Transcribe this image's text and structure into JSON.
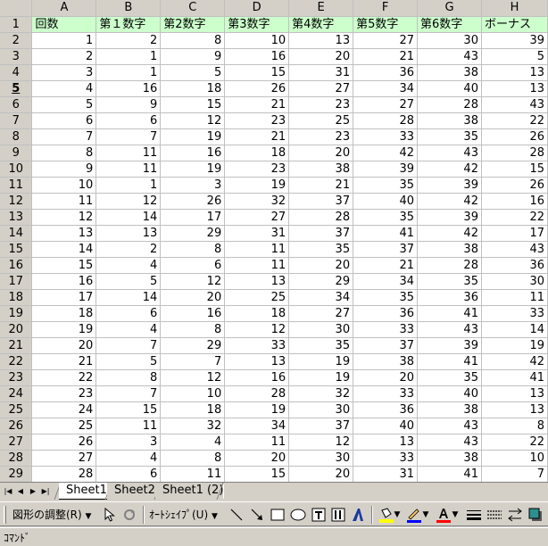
{
  "columns": [
    "A",
    "B",
    "C",
    "D",
    "E",
    "F",
    "G",
    "H"
  ],
  "header_row": [
    "回数",
    "第１数字",
    "第2数字",
    "第3数字",
    "第4数字",
    "第5数字",
    "第6数字",
    "ボーナス"
  ],
  "active_row": "5",
  "rows": [
    [
      1,
      2,
      8,
      10,
      13,
      27,
      30,
      39
    ],
    [
      2,
      1,
      9,
      16,
      20,
      21,
      43,
      5
    ],
    [
      3,
      1,
      5,
      15,
      31,
      36,
      38,
      13
    ],
    [
      4,
      16,
      18,
      26,
      27,
      34,
      40,
      13
    ],
    [
      5,
      9,
      15,
      21,
      23,
      27,
      28,
      43
    ],
    [
      6,
      6,
      12,
      23,
      25,
      28,
      38,
      22
    ],
    [
      7,
      7,
      19,
      21,
      23,
      33,
      35,
      26
    ],
    [
      8,
      11,
      16,
      18,
      20,
      42,
      43,
      28
    ],
    [
      9,
      11,
      19,
      23,
      38,
      39,
      42,
      15
    ],
    [
      10,
      1,
      3,
      19,
      21,
      35,
      39,
      26
    ],
    [
      11,
      12,
      26,
      32,
      37,
      40,
      42,
      16
    ],
    [
      12,
      14,
      17,
      27,
      28,
      35,
      39,
      22
    ],
    [
      13,
      13,
      29,
      31,
      37,
      41,
      42,
      17
    ],
    [
      14,
      2,
      8,
      11,
      35,
      37,
      38,
      43
    ],
    [
      15,
      4,
      6,
      11,
      20,
      21,
      28,
      36
    ],
    [
      16,
      5,
      12,
      13,
      29,
      34,
      35,
      30
    ],
    [
      17,
      14,
      20,
      25,
      34,
      35,
      36,
      11
    ],
    [
      18,
      6,
      16,
      18,
      27,
      36,
      41,
      33
    ],
    [
      19,
      4,
      8,
      12,
      30,
      33,
      43,
      14
    ],
    [
      20,
      7,
      29,
      33,
      35,
      37,
      39,
      19
    ],
    [
      21,
      5,
      7,
      13,
      19,
      38,
      41,
      42
    ],
    [
      22,
      8,
      12,
      16,
      19,
      20,
      35,
      41
    ],
    [
      23,
      7,
      10,
      28,
      32,
      33,
      40,
      13
    ],
    [
      24,
      15,
      18,
      19,
      30,
      36,
      38,
      13
    ],
    [
      25,
      11,
      32,
      34,
      37,
      40,
      43,
      8
    ],
    [
      26,
      3,
      4,
      11,
      12,
      13,
      43,
      22
    ],
    [
      27,
      4,
      8,
      20,
      30,
      33,
      38,
      10
    ],
    [
      28,
      6,
      11,
      15,
      20,
      31,
      41,
      7
    ]
  ],
  "sheet_tabs": [
    "Sheet1",
    "Sheet2",
    "Sheet1 (2)"
  ],
  "active_sheet": "Sheet1",
  "drawing_toolbar": {
    "draw_menu": "図形の調整(R)",
    "autoshapes_menu": "ｵｰﾄｼｪｲﾌﾟ(U)"
  },
  "status": "ｺﾏﾝﾄﾞ",
  "colors": {
    "header_fill": "#ccffcc",
    "font_color_bar": "#ff0000",
    "fill_color_bar": "#ffff00",
    "line_color_bar": "#0000ff"
  }
}
